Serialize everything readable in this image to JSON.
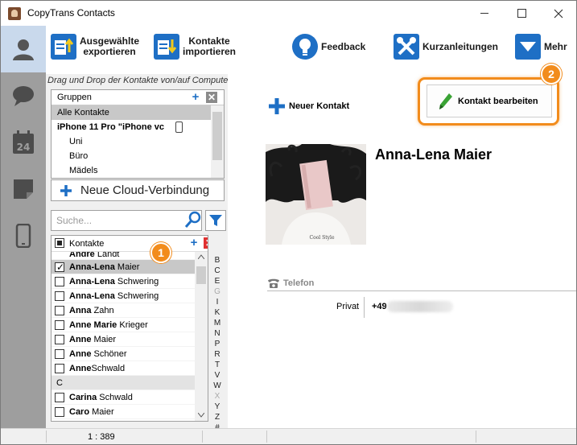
{
  "window": {
    "title": "CopyTrans Contacts"
  },
  "toolbar": {
    "export_label_1": "Ausgewählte",
    "export_label_2": "exportieren",
    "import_label_1": "Kontakte",
    "import_label_2": "importieren",
    "feedback_label": "Feedback",
    "guides_label": "Kurzanleitungen",
    "more_label": "Mehr"
  },
  "hint": "Drag und Drop der Kontakte von/auf Computer",
  "groups": {
    "header": "Gruppen",
    "items": [
      {
        "label": "Alle Kontakte"
      },
      {
        "label": "iPhone 11 Pro \"iPhone vc"
      },
      {
        "label": "Uni"
      },
      {
        "label": "Büro"
      },
      {
        "label": "Mädels"
      }
    ]
  },
  "cloud": {
    "label": "Neue Cloud-Verbindung"
  },
  "search": {
    "placeholder": "Suche..."
  },
  "contacts": {
    "header": "Kontakte",
    "rows": [
      {
        "bold": "Andre",
        "rest": " Landt"
      },
      {
        "bold": "Anna-Lena",
        "rest": " Maier"
      },
      {
        "bold": "Anna-Lena",
        "rest": " Schwering"
      },
      {
        "bold": "Anna-Lena",
        "rest": " Schwering"
      },
      {
        "bold": "Anna",
        "rest": " Zahn"
      },
      {
        "bold": "Anne Marie",
        "rest": " Krieger"
      },
      {
        "bold": "Anne",
        "rest": " Maier"
      },
      {
        "bold": "Anne",
        "rest": " Schöner"
      },
      {
        "bold": "Anne",
        "rest": "Schwald"
      },
      {
        "letter": "C"
      },
      {
        "bold": "Carina",
        "rest": " Schwald"
      },
      {
        "bold": "Caro",
        "rest": " Maier"
      }
    ]
  },
  "alphabet": [
    "B",
    "C",
    "E",
    "G",
    "I",
    "K",
    "M",
    "N",
    "P",
    "R",
    "T",
    "V",
    "W",
    "X",
    "Y",
    "Z",
    "#"
  ],
  "detail": {
    "new_contact": "Neuer Kontakt",
    "edit_contact": "Kontakt bearbeiten",
    "name": "Anna-Lena Maier",
    "phone_section": "Telefon",
    "phone_label": "Privat",
    "phone_prefix": "+49"
  },
  "badges": {
    "one": "1",
    "two": "2"
  },
  "status": {
    "count": "1 : 389"
  },
  "colors": {
    "accent": "#f28c1c",
    "toolbar_blue": "#1e6fc5",
    "rail": "#9e9e9e",
    "rail_active": "#c9d9ec"
  }
}
